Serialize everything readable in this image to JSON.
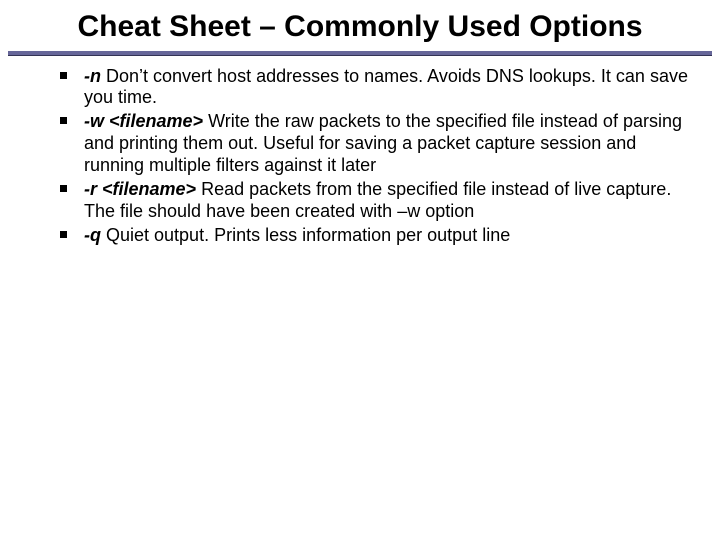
{
  "title": "Cheat Sheet – Commonly Used Options",
  "items": [
    {
      "flag": "-n",
      "desc": " Don’t convert host addresses to names. Avoids DNS lookups.  It can save you time."
    },
    {
      "flag": "-w <filename>",
      "desc": " Write the raw packets to the specified file instead of parsing and printing them out.  Useful for saving a packet capture session and running multiple filters against it later"
    },
    {
      "flag": "-r <filename>",
      "desc": " Read packets from the specified file instead of live capture.  The file should have been created with –w option"
    },
    {
      "flag": "-q",
      "desc": " Quiet output.  Prints less information per output line"
    }
  ]
}
